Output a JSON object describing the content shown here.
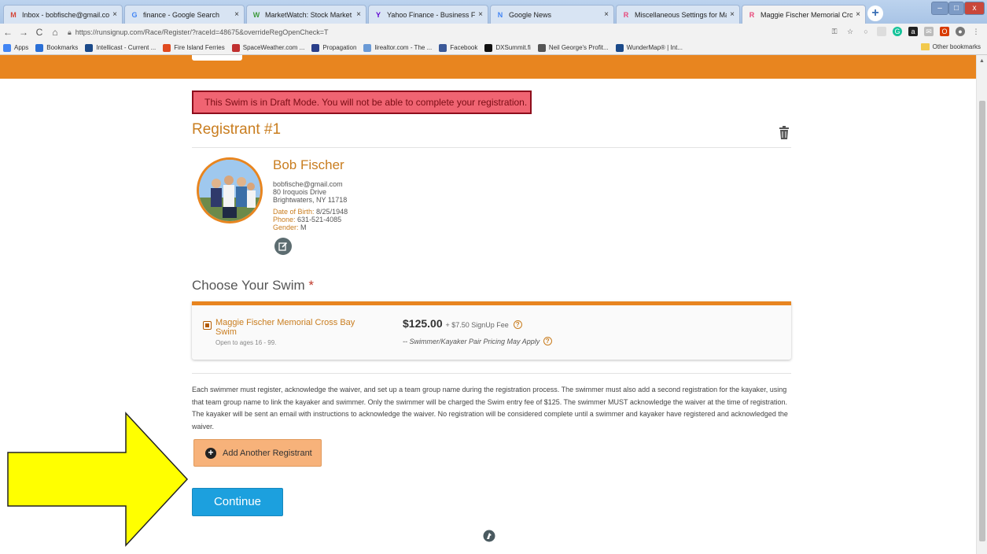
{
  "browser": {
    "tabs": [
      {
        "label": "Inbox - bobfische@gmail.com - ",
        "fav": "M",
        "favColor": "#d44638"
      },
      {
        "label": "finance - Google Search",
        "fav": "G",
        "favColor": "#4285f4"
      },
      {
        "label": "MarketWatch: Stock Market New",
        "fav": "W",
        "favColor": "#3e9a3c"
      },
      {
        "label": "Yahoo Finance - Business Financ",
        "fav": "Y",
        "favColor": "#5f01d1"
      },
      {
        "label": "Google News",
        "fav": "N",
        "favColor": "#4285f4"
      },
      {
        "label": "Miscellaneous Settings for Magg",
        "fav": "R",
        "favColor": "#e8487a"
      },
      {
        "label": "Maggie Fischer Memorial Cross B",
        "fav": "R",
        "favColor": "#e8487a"
      }
    ],
    "url": "https://runsignup.com/Race/Register/?raceId=48675&overrideRegOpenCheck=T",
    "bookmarks": [
      {
        "label": "Apps",
        "color": "#4285f4"
      },
      {
        "label": "Bookmarks",
        "color": "#2a6fd6"
      },
      {
        "label": "Intellicast - Current ...",
        "color": "#1b4a8a"
      },
      {
        "label": "Fire Island Ferries",
        "color": "#e04a1f"
      },
      {
        "label": "SpaceWeather.com ...",
        "color": "#c03030"
      },
      {
        "label": "Propagation",
        "color": "#2a3f8a"
      },
      {
        "label": "lirealtor.com - The ...",
        "color": "#6a9ad6"
      },
      {
        "label": "Facebook",
        "color": "#3b5998"
      },
      {
        "label": "DXSummit.fi",
        "color": "#111111"
      },
      {
        "label": "Neil George's Profit...",
        "color": "#555555"
      },
      {
        "label": "WunderMap® | Int...",
        "color": "#1b4a8a"
      }
    ],
    "other_bookmarks": "Other bookmarks"
  },
  "page": {
    "draft_alert": "This Swim is in Draft Mode. You will not be able to complete your registration.",
    "registrant_title": "Registrant #1",
    "person": {
      "name": "Bob Fischer",
      "email": "bobfische@gmail.com",
      "address1": "80 Iroquois Drive",
      "address2": "Brightwaters, NY 11718",
      "dob_label": "Date of Birth:",
      "dob": "8/25/1948",
      "phone_label": "Phone:",
      "phone": "631-521-4085",
      "gender_label": "Gender:",
      "gender": "M"
    },
    "choose_title": "Choose Your Swim",
    "required_mark": "*",
    "swim": {
      "name": "Maggie Fischer Memorial Cross Bay Swim",
      "ages": "Open to ages 16 - 99.",
      "price": "$125.00",
      "fee": "+ $7.50 SignUp Fee",
      "pair_note": "-- Swimmer/Kayaker Pair Pricing May Apply"
    },
    "instructions": "Each swimmer must register, acknowledge the waiver, and set up a team group name during the registration process. The swimmer must also add a second registration for the kayaker, using that team group name to link the kayaker and swimmer. Only the swimmer will be charged the Swim entry fee of $125. The swimmer MUST acknowledge the waiver at the time of registration. The kayaker will be sent an email with instructions to acknowledge the waiver. No registration will be considered complete until a swimmer and kayaker have registered and acknowledged the waiver.",
    "add_button": "Add Another Registrant",
    "continue_button": "Continue"
  },
  "colors": {
    "brand_orange": "#e8851f",
    "alert_red": "#f06472",
    "continue_blue": "#1ca0de",
    "annotation_arrow": "#ffff00"
  }
}
